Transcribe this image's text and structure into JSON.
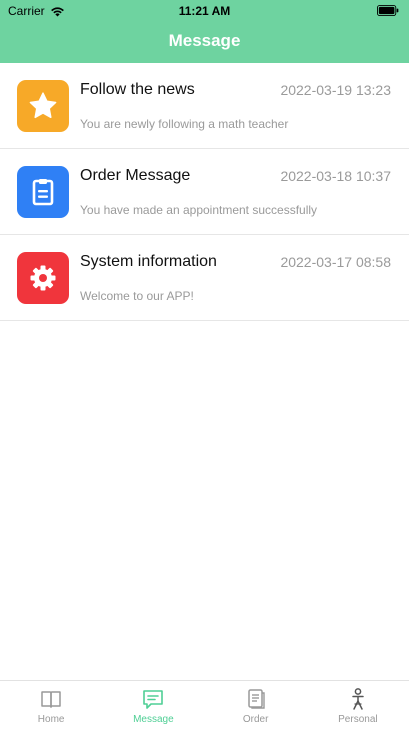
{
  "status_bar": {
    "carrier": "Carrier",
    "time": "11:21 AM",
    "wifi_icon": "wifi-icon",
    "battery_icon": "battery-icon"
  },
  "header": {
    "title": "Message",
    "background_color": "#6ed3a0"
  },
  "messages": [
    {
      "title": "Follow the news",
      "time": "2022-03-19 13:23",
      "subtitle": "You are newly following a math teacher",
      "icon": "star-icon",
      "icon_color": "#f7a928"
    },
    {
      "title": "Order Message",
      "time": "2022-03-18 10:37",
      "subtitle": "You have made an appointment successfully",
      "icon": "clipboard-icon",
      "icon_color": "#2f80f5"
    },
    {
      "title": "System information",
      "time": "2022-03-17 08:58",
      "subtitle": "Welcome to our APP!",
      "icon": "gear-icon",
      "icon_color": "#f0353c"
    }
  ],
  "tabbar": {
    "active_color": "#4fcf95",
    "tabs": [
      {
        "label": "Home",
        "icon": "book-icon",
        "active": false
      },
      {
        "label": "Message",
        "icon": "chat-icon",
        "active": true
      },
      {
        "label": "Order",
        "icon": "document-icon",
        "active": false
      },
      {
        "label": "Personal",
        "icon": "person-icon",
        "active": false
      }
    ]
  }
}
